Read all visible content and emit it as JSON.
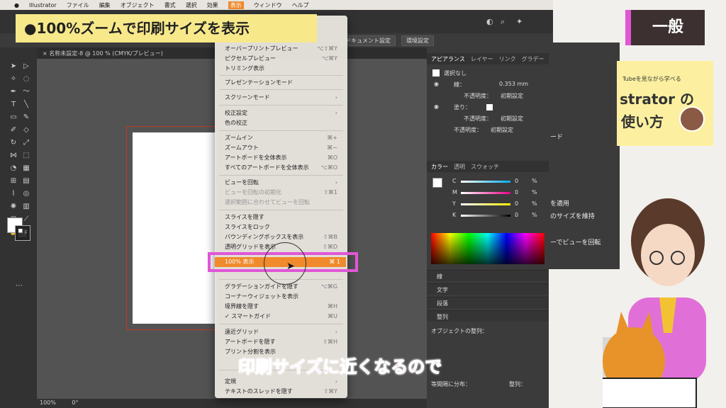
{
  "menubar": {
    "items": [
      "Illustrator",
      "ファイル",
      "編集",
      "オブジェクト",
      "書式",
      "選択",
      "効果",
      "表示",
      "ウィンドウ",
      "ヘルプ"
    ]
  },
  "control_bar": {
    "doc_setup": "ドキュメント設定",
    "env_setup": "環境設定"
  },
  "document_tab": {
    "title": "名称未設定-8 @ 100 % (CMYK/プレビュー)"
  },
  "status": {
    "zoom": "100%",
    "angle": "0°"
  },
  "banner": {
    "text": "●100%ズームで印刷サイズを表示"
  },
  "subtitle": {
    "text": "印刷サイズに近くなるので"
  },
  "brand": {
    "label": "一般",
    "promo_line1": "Tubeを見ながら学べる",
    "promo_line2": "strator の",
    "promo_line3": "使い方"
  },
  "behind_texts": [
    "ード",
    "を適用",
    "のサイズを維持",
    "ーでビューを回転"
  ],
  "view_menu": {
    "top": [
      {
        "label": "オーバープリントプレビュー",
        "shortcut": "⌥⇧⌘Y"
      },
      {
        "label": "ピクセルプレビュー",
        "shortcut": "⌥⌘Y"
      },
      {
        "label": "トリミング表示",
        "shortcut": ""
      }
    ],
    "group2": [
      {
        "label": "プレゼンテーションモード",
        "shortcut": ""
      }
    ],
    "group3": [
      {
        "label": "スクリーンモード",
        "shortcut": "›"
      }
    ],
    "group4": [
      {
        "label": "校正設定",
        "shortcut": "›"
      },
      {
        "label": "色の校正",
        "shortcut": ""
      }
    ],
    "group5": [
      {
        "label": "ズームイン",
        "shortcut": "⌘+"
      },
      {
        "label": "ズームアウト",
        "shortcut": "⌘−"
      },
      {
        "label": "アートボードを全体表示",
        "shortcut": "⌘O"
      },
      {
        "label": "すべてのアートボードを全体表示",
        "shortcut": "⌥⌘O"
      }
    ],
    "group6": [
      {
        "label": "ビューを回転",
        "shortcut": "›"
      },
      {
        "label": "ビューを回転の初期化",
        "shortcut": "⇧⌘1"
      },
      {
        "label": "選択範囲に合わせてビューを回転",
        "shortcut": ""
      }
    ],
    "group7": [
      {
        "label": "スライスを隠す",
        "shortcut": ""
      },
      {
        "label": "スライスをロック",
        "shortcut": ""
      },
      {
        "label": "バウンディングボックスを表示",
        "shortcut": "⇧⌘B"
      },
      {
        "label": "透明グリッドを表示",
        "shortcut": "⇧⌘D"
      }
    ],
    "highlighted": {
      "label": "100% 表示",
      "shortcut": "⌘ 1"
    },
    "group8": [
      {
        "label": "グラデーションガイドを隠す",
        "shortcut": "⌥⌘G"
      },
      {
        "label": "コーナーウィジェットを表示",
        "shortcut": ""
      },
      {
        "label": "境界線を隠す",
        "shortcut": "⌘H"
      },
      {
        "label": "✓ スマートガイド",
        "shortcut": "⌘U"
      }
    ],
    "group9": [
      {
        "label": "遠近グリッド",
        "shortcut": "›"
      },
      {
        "label": "アートボードを隠す",
        "shortcut": "⇧⌘H"
      },
      {
        "label": "プリント分割を表示",
        "shortcut": ""
      }
    ],
    "group10": [
      {
        "label": "定規",
        "shortcut": "›"
      },
      {
        "label": "テキストのスレッドを隠す",
        "shortcut": "⇧⌘Y"
      }
    ]
  },
  "appearance_panel": {
    "tabs": [
      "アピアランス",
      "レイヤー",
      "リンク",
      "グラデー"
    ],
    "selection": "選択なし",
    "stroke_label": "線：",
    "stroke_value": "0.353 mm",
    "opacity_label": "不透明度：",
    "opacity_value": "初期設定",
    "fill_label": "塗り："
  },
  "color_panel": {
    "tabs": [
      "カラー",
      "透明",
      "スウォッチ"
    ],
    "channels": [
      {
        "name": "C",
        "value": "0",
        "unit": "%"
      },
      {
        "name": "M",
        "value": "0",
        "unit": "%"
      },
      {
        "name": "Y",
        "value": "0",
        "unit": "%"
      },
      {
        "name": "K",
        "value": "0",
        "unit": "%"
      }
    ]
  },
  "collapsed_panels": [
    "線",
    "文字",
    "段落",
    "整列"
  ],
  "align_panel": {
    "align_objects": "オブジェクトの整列：",
    "distribute": "等間隔に分布：",
    "align_to": "整列："
  }
}
